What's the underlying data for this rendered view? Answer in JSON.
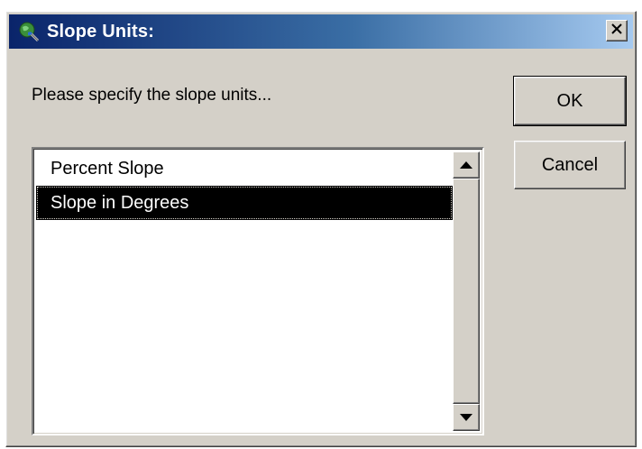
{
  "window": {
    "title": "Slope Units:",
    "icon": "globe-search-icon",
    "close_glyph": "close-icon"
  },
  "dialog": {
    "prompt": "Please specify the slope units...",
    "ok_label": "OK",
    "cancel_label": "Cancel"
  },
  "listbox": {
    "items": [
      {
        "label": "Percent Slope",
        "selected": false
      },
      {
        "label": "Slope in Degrees",
        "selected": true
      }
    ],
    "selected_value": "Slope in Degrees"
  },
  "colors": {
    "titlebar_start": "#0a246a",
    "titlebar_end": "#a6caf0",
    "dialog_face": "#d4d0c8",
    "selection_bg": "#000000",
    "selection_text": "#ffffff"
  }
}
